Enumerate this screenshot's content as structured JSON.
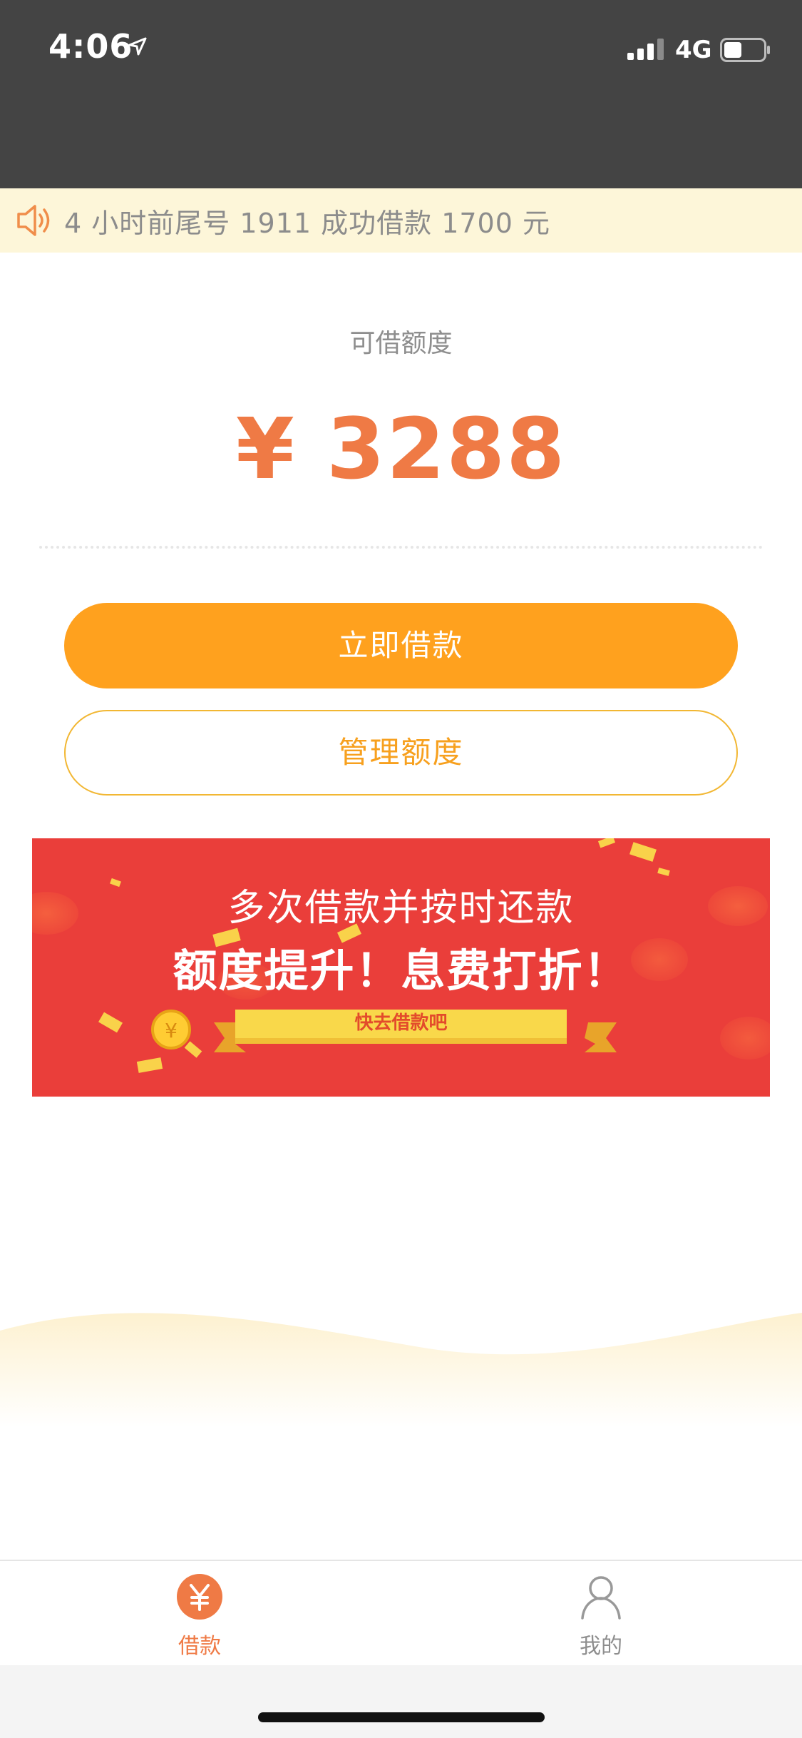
{
  "status_bar": {
    "time": "4:06",
    "network": "4G",
    "icons": [
      "location-arrow-icon",
      "signal-icon",
      "battery-icon"
    ]
  },
  "notice": {
    "icon": "speaker-icon",
    "text": "4 小时前尾号 1911 成功借款 1700 元"
  },
  "quota": {
    "label": "可借额度",
    "amount": "¥ 3288"
  },
  "actions": {
    "borrow_label": "立即借款",
    "manage_label": "管理额度"
  },
  "promo": {
    "line1": "多次借款并按时还款",
    "line2": "额度提升！息费打折！",
    "ribbon_text": "快去借款吧"
  },
  "tab_bar": {
    "items": [
      {
        "label": "借款",
        "icon": "yuan-icon",
        "active": true
      },
      {
        "label": "我的",
        "icon": "user-icon",
        "active": false
      }
    ]
  },
  "colors": {
    "accent": "#ffa11e",
    "amount": "#ef7a45",
    "banner": "#ea3e3a",
    "status_bar": "#444444",
    "notice_bg": "#fdf6d9"
  }
}
